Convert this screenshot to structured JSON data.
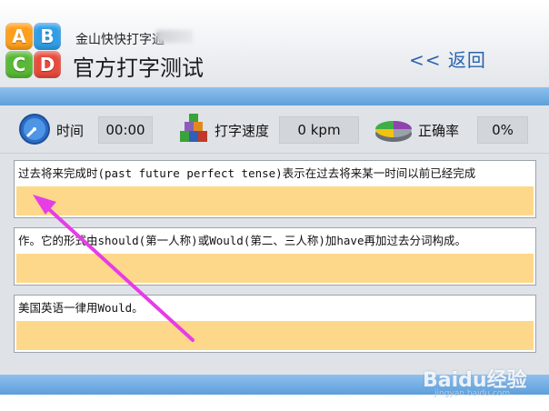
{
  "header": {
    "app_name": "金山快快打字通",
    "page_title": "官方打字测试",
    "back_label": "<< 返回",
    "logo_letters": [
      "A",
      "B",
      "C",
      "D"
    ]
  },
  "stats": {
    "time_label": "时间",
    "time_value": "00:00",
    "speed_label": "打字速度",
    "speed_value": "0 kpm",
    "accuracy_label": "正确率",
    "accuracy_value": "0%"
  },
  "lines": [
    {
      "text": "过去将来完成时(past future perfect tense)表示在过去将来某一时间以前已经完成",
      "typed": ""
    },
    {
      "text": "作。它的形式由should(第一人称)或Would(第二、三人称)加have再加过去分词构成。",
      "typed": ""
    },
    {
      "text": "美国英语一律用Would。",
      "typed": ""
    }
  ],
  "watermark": {
    "brand": "Baidu经验",
    "url": "jingyan.baidu.com"
  },
  "colors": {
    "accent_blue": "#5d9fdc",
    "input_fill": "#fed88a",
    "annotation_arrow": "#e63de6",
    "back_link": "#2a63ad"
  },
  "icons": [
    "clock-icon",
    "speed-blocks-icon",
    "accuracy-pie-icon"
  ]
}
